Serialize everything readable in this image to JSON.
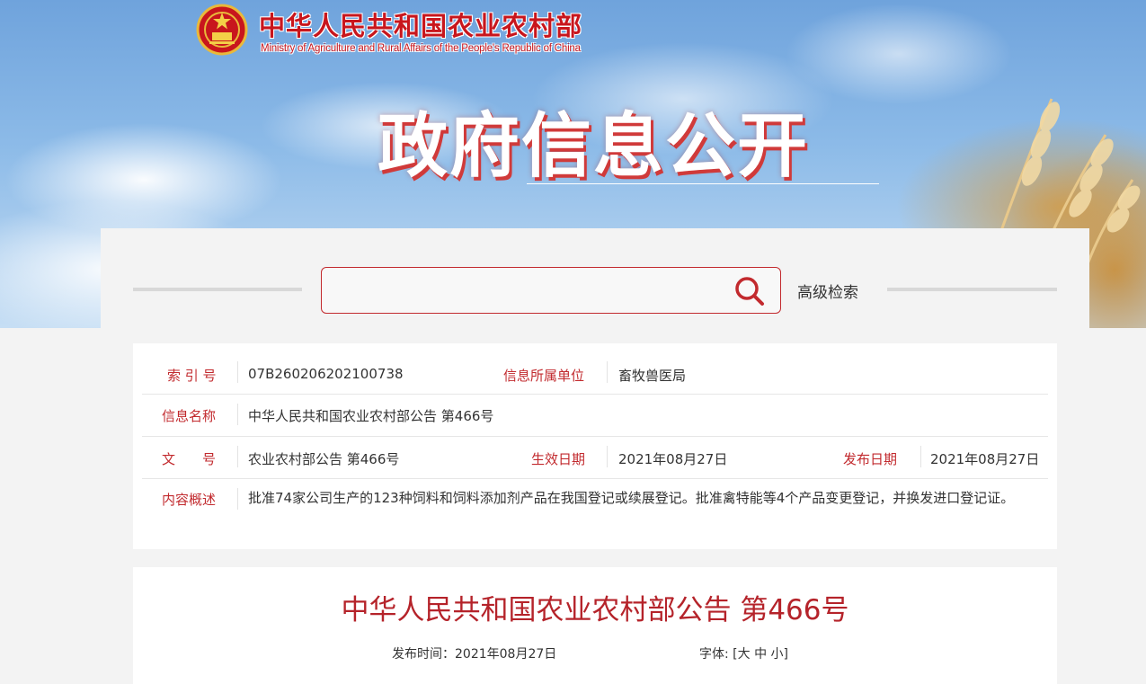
{
  "header": {
    "org_name_cn": "中华人民共和国农业农村部",
    "org_name_en": "Ministry of Agriculture and Rural Affairs of the People's Republic of China",
    "banner_title": "政府信息公开",
    "emblem_icon": "national-emblem-icon"
  },
  "search": {
    "placeholder": "",
    "value": "",
    "icon": "search-icon",
    "advanced_label": "高级检索"
  },
  "info": {
    "index_label": "索 引 号",
    "index_value": "07B260206202100738",
    "unit_label": "信息所属单位",
    "unit_value": "畜牧兽医局",
    "name_label": "信息名称",
    "name_value": "中华人民共和国农业农村部公告 第466号",
    "doc_label": "文　　号",
    "doc_value": "农业农村部公告 第466号",
    "effective_label": "生效日期",
    "effective_value": "2021年08月27日",
    "publish_label": "发布日期",
    "publish_value": "2021年08月27日",
    "summary_label": "内容概述",
    "summary_value": "批准74家公司生产的123种饲料和饲料添加剂产品在我国登记或续展登记。批准禽特能等4个产品变更登记，并换发进口登记证。"
  },
  "article": {
    "title": "中华人民共和国农业农村部公告 第466号",
    "publish_time_label": "发布时间：",
    "publish_time_value": "2021年08月27日",
    "font_label": "字体:",
    "font_open": "[",
    "font_large": "大",
    "font_medium": "中",
    "font_small": "小",
    "font_close": "]"
  },
  "colors": {
    "accent_red": "#c22a2e",
    "title_red": "#b5232a",
    "sky_blue": "#8dbbe8"
  }
}
